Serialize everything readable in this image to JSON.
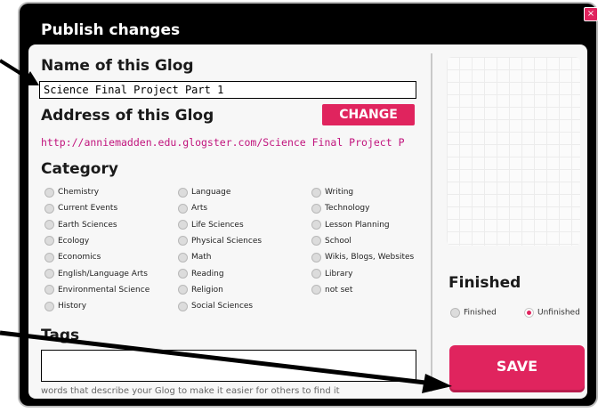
{
  "dialog": {
    "title": "Publish changes",
    "close_symbol": "×"
  },
  "name_section": {
    "heading": "Name of this Glog",
    "value": "Science Final Project Part 1"
  },
  "address_section": {
    "heading": "Address of this Glog",
    "change_label": "CHANGE",
    "url": "http://anniemadden.edu.glogster.com/Science Final Project P"
  },
  "category_section": {
    "heading": "Category",
    "columns": [
      [
        "Chemistry",
        "Current Events",
        "Earth Sciences",
        "Ecology",
        "Economics",
        "English/Language Arts",
        "Environmental Science",
        "History"
      ],
      [
        "Language",
        "Arts",
        "Life Sciences",
        "Physical Sciences",
        "Math",
        "Reading",
        "Religion",
        "Social Sciences"
      ],
      [
        "Writing",
        "Technology",
        "Lesson Planning",
        "School",
        "Wikis, Blogs, Websites",
        "Library",
        "not set"
      ]
    ]
  },
  "tags_section": {
    "heading": "Tags",
    "value": "",
    "hint": "words that describe your Glog to make it easier for others to find it"
  },
  "status_section": {
    "heading": "Finished",
    "options": [
      "Finished",
      "Unfinished"
    ],
    "selected": "Unfinished"
  },
  "save_label": "SAVE",
  "colors": {
    "accent": "#e0245e",
    "url": "#c1147d",
    "frame": "#000000"
  }
}
